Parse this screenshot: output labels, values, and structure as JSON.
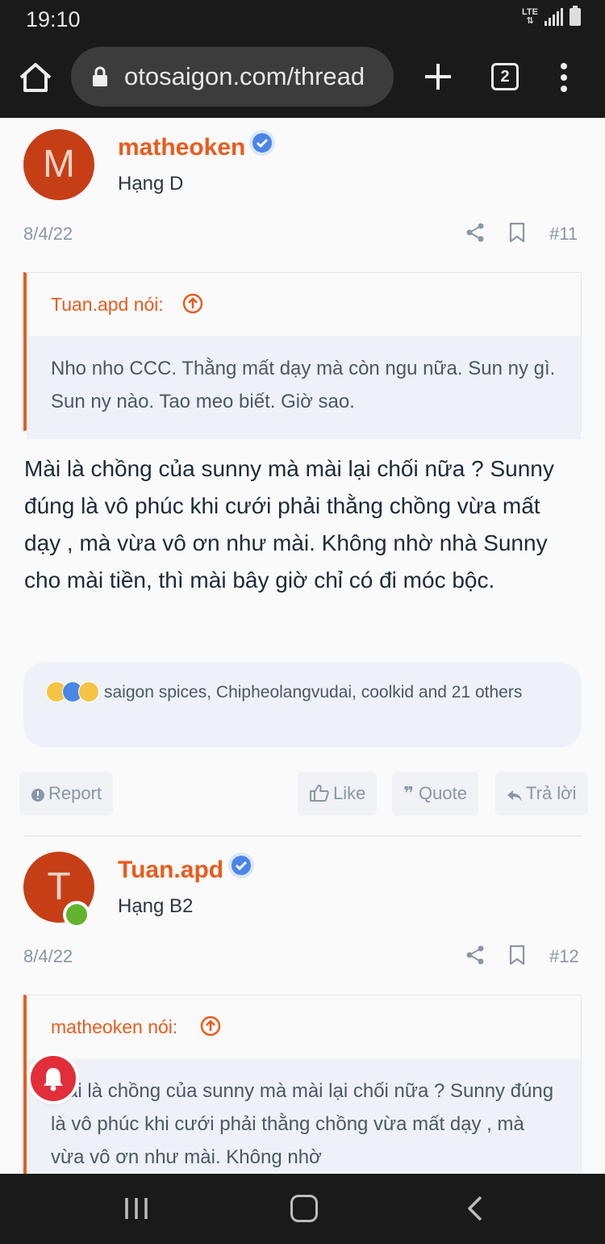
{
  "status_bar": {
    "time": "19:10",
    "network": "LTE"
  },
  "browser": {
    "url": "otosaigon.com/thread",
    "tab_count": "2"
  },
  "posts": [
    {
      "avatar_letter": "M",
      "username": "matheoken",
      "rank": "Hạng D",
      "date": "8/4/22",
      "number": "#11",
      "quote": {
        "author": "Tuan.apd nói:",
        "text": "Nho nho CCC. Thằng mất dạy mà còn ngu nữa. Sun ny gì. Sun ny nào. Tao meo biết. Giờ sao."
      },
      "body": "Mài là chồng của sunny mà mài lại chối nữa ? Sunny đúng là vô phúc khi cưới phải thằng chồng vừa mất dạy , mà vừa vô ơn như mài. Không nhờ nhà Sunny cho mài tiền, thì mài bây giờ chỉ có đi móc bộc.",
      "reactions": "saigon spices, Chipheolangvudai, coolkid and 21 others"
    },
    {
      "avatar_letter": "T",
      "username": "Tuan.apd",
      "rank": "Hạng B2",
      "date": "8/4/22",
      "number": "#12",
      "quote": {
        "author": "matheoken nói:",
        "text": "Mài là chồng của sunny mà mài lại chối nữa ? Sunny đúng là vô phúc khi cưới phải thằng chồng vừa mất dạy , mà vừa vô ơn như mài. Không nhờ"
      }
    }
  ],
  "actions": {
    "report": "Report",
    "like": "Like",
    "quote": "Quote",
    "reply": "Trả lời"
  },
  "colors": {
    "accent": "#e85c1e",
    "avatar": "#c63e16",
    "verified": "#4a86e8",
    "online": "#63b32e",
    "notification": "#e12e3a"
  }
}
